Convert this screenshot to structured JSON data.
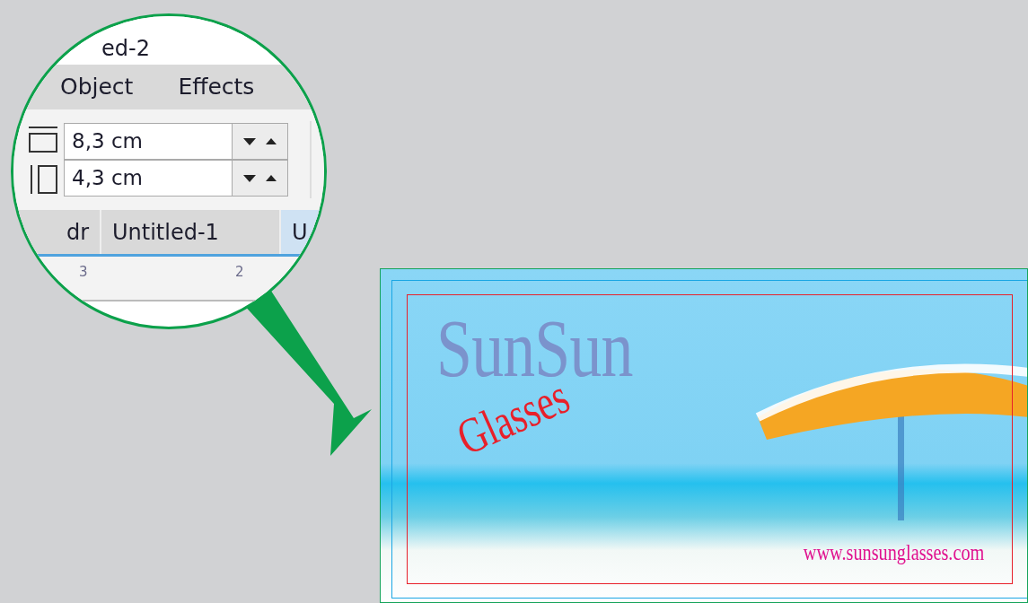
{
  "magnifier": {
    "title": "ed-2",
    "menu": [
      {
        "label": "Object"
      },
      {
        "label": "Effects"
      }
    ],
    "size_fields": [
      {
        "kind": "width",
        "value": "8,3 cm"
      },
      {
        "kind": "height",
        "value": "4,3 cm"
      }
    ],
    "tabs": [
      {
        "label": "dr",
        "selected": false
      },
      {
        "label": "Untitled-1",
        "selected": false
      },
      {
        "label": "U",
        "selected": true
      }
    ],
    "ruler_labels": [
      "3",
      "2"
    ]
  },
  "card": {
    "title": "SunSun",
    "subtitle": "Glasses",
    "website": "www.sunsunglasses.com"
  }
}
